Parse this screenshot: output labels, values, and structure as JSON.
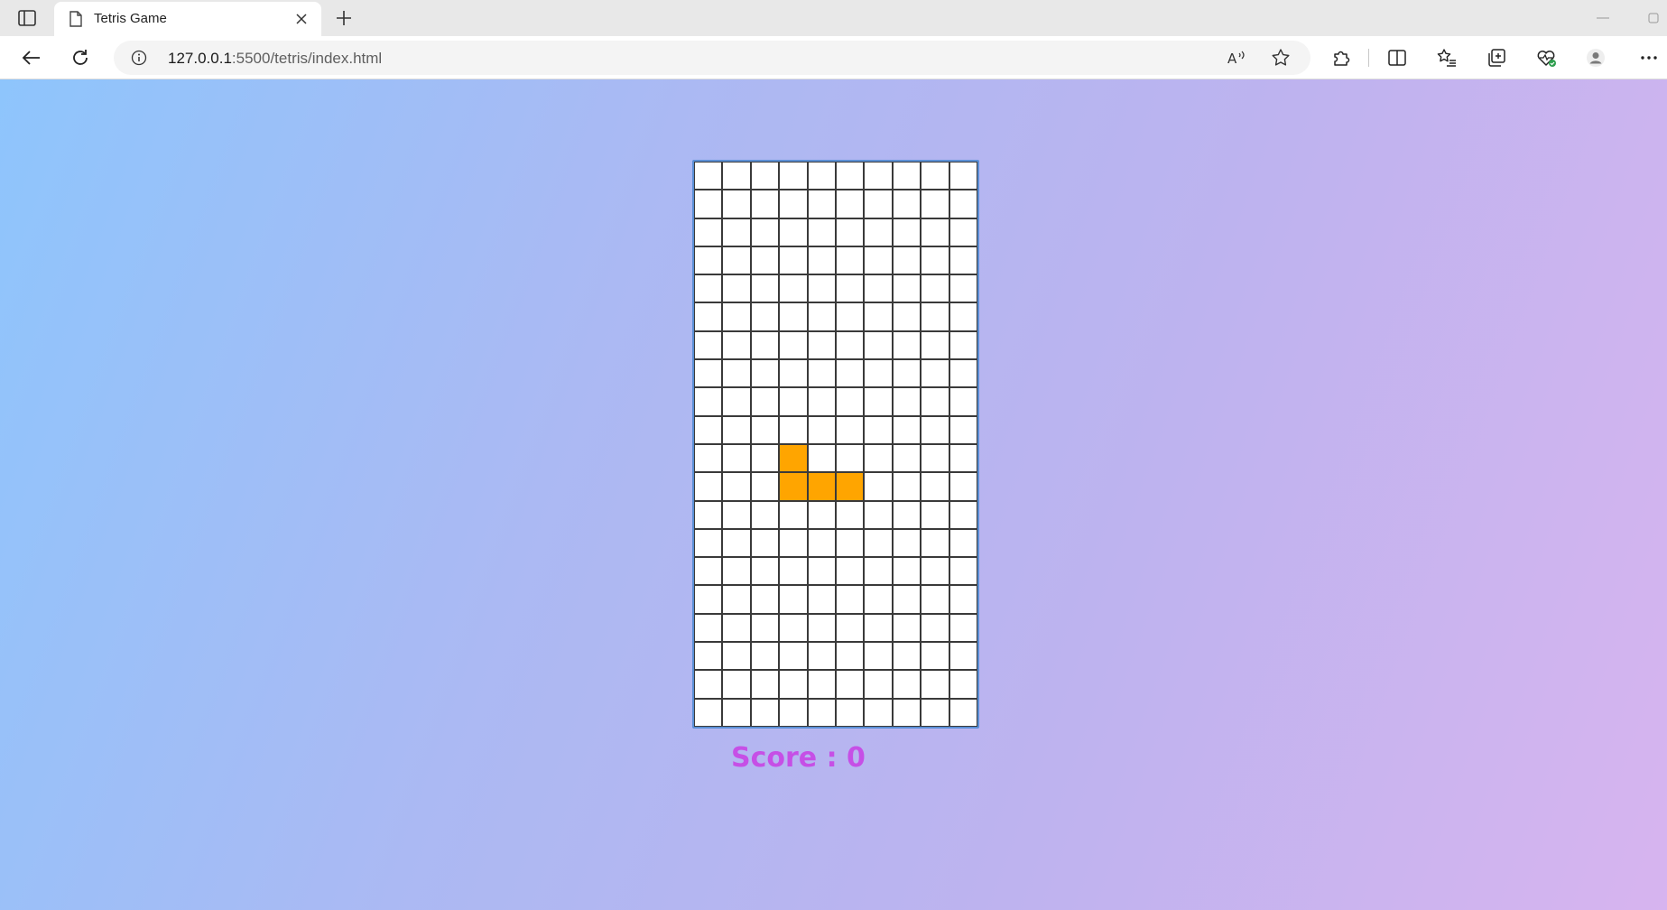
{
  "browser": {
    "tab": {
      "title": "Tetris Game"
    },
    "address": {
      "host": "127.0.0.1",
      "path": ":5500/tetris/index.html"
    }
  },
  "icons": {
    "sidebar_toggle": "sidebar-toggle-icon",
    "favicon": "page-icon",
    "close": "close-icon",
    "new_tab": "plus-icon",
    "back": "arrow-left-icon",
    "refresh": "refresh-icon",
    "site_info": "info-icon",
    "read_aloud": "read-aloud-icon",
    "favorite": "star-icon",
    "extensions": "puzzle-icon",
    "split_screen": "split-screen-icon",
    "favorites": "favorites-list-icon",
    "collections": "collections-icon",
    "performance": "heartbeat-icon",
    "profile": "profile-icon",
    "more": "more-icon"
  },
  "game": {
    "board": {
      "columns": 10,
      "rows": 20
    },
    "piece": {
      "shape": "J",
      "color": "#ffa500",
      "cells": [
        [
          10,
          3
        ],
        [
          11,
          3
        ],
        [
          11,
          4
        ],
        [
          11,
          5
        ]
      ]
    },
    "score_label": "Score : 0"
  },
  "colors": {
    "board_border": "#5b8fd6",
    "grid_lines": "#3a3a3a",
    "score_text": "#c64fe6",
    "background_start": "#8ec5fc",
    "background_end": "#d7b4ef"
  }
}
